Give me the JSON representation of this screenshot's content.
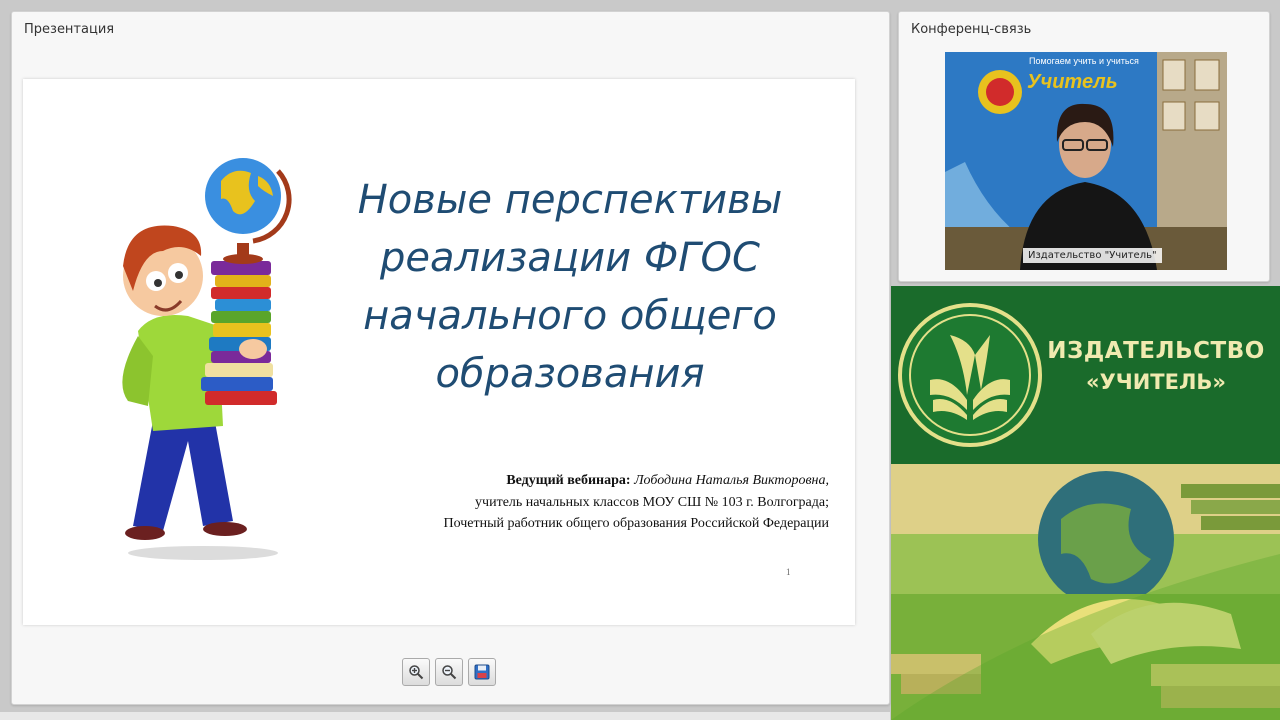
{
  "presentation": {
    "panel_title": "Презентация",
    "slide": {
      "title": "Новые перспективы\nреализации ФГОС\nначального общего\nобразования",
      "presenter_label": "Ведущий вебинара:",
      "presenter_name": "Лободина Наталья Викторовна,",
      "presenter_position": "учитель начальных классов МОУ СШ № 103 г. Волгограда;",
      "presenter_honor": "Почетный работник общего образования Российской Федерации",
      "page_number": "1"
    },
    "toolbar": [
      {
        "name": "zoom-in-icon"
      },
      {
        "name": "zoom-out-icon"
      },
      {
        "name": "save-icon"
      }
    ]
  },
  "conference": {
    "panel_title": "Конференц-связь",
    "video_caption": "Издательство \"Учитель\"",
    "banner_text": "Помогаем учить и учиться",
    "banner_brand": "Учитель"
  },
  "advert": {
    "brand_line1": "ИЗДАТЕЛЬСТВО",
    "brand_line2": "«УЧИТЕЛЬ»",
    "colors": {
      "background": "#1a6b2b",
      "text": "#f0eab0"
    }
  }
}
